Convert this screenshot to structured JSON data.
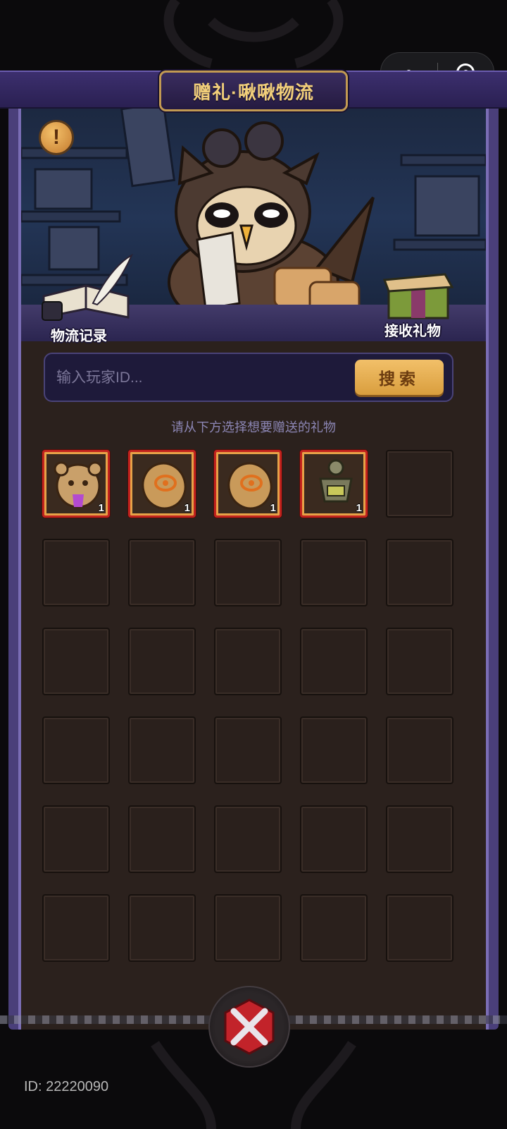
{
  "header": {
    "title": "赠礼·啾啾物流"
  },
  "hero": {
    "logistics_record_label": "物流记录",
    "receive_gift_label": "接收礼物",
    "info_icon_glyph": "!"
  },
  "search": {
    "placeholder": "输入玩家ID...",
    "button_label": "搜索"
  },
  "hint": "请从下方选择想要赠送的礼物",
  "gifts": [
    {
      "icon": "bear-head-icon",
      "count": "1"
    },
    {
      "icon": "eye-rune-stone-icon",
      "count": "1"
    },
    {
      "icon": "eye-rune-stone-icon",
      "count": "1"
    },
    {
      "icon": "armor-figure-icon",
      "count": "1"
    }
  ],
  "grid": {
    "columns": 5,
    "rows": 6
  },
  "footer": {
    "user_id": "ID: 22220090"
  },
  "colors": {
    "panel_bg": "#2b211d",
    "frame_purple": "#4a3f7a",
    "accent_gold": "#f2c069",
    "slot_highlight": "#c2231e"
  }
}
